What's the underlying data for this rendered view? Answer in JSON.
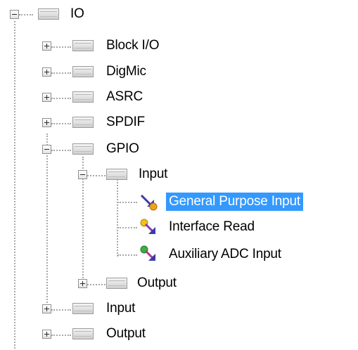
{
  "tree": {
    "root": {
      "label": "IO",
      "expanded": true
    },
    "items": [
      {
        "label": "Block I/O",
        "expanded": false,
        "icon": "folder-icon"
      },
      {
        "label": "DigMic",
        "expanded": false,
        "icon": "folder-icon"
      },
      {
        "label": "ASRC",
        "expanded": false,
        "icon": "folder-icon"
      },
      {
        "label": "SPDIF",
        "expanded": false,
        "icon": "folder-icon"
      },
      {
        "label": "GPIO",
        "expanded": true,
        "icon": "folder-icon"
      },
      {
        "label": "Input",
        "expanded": true,
        "icon": "folder-icon"
      },
      {
        "label": "General Purpose Input",
        "selected": true,
        "icon": "gpio-input-icon"
      },
      {
        "label": "Interface Read",
        "selected": false,
        "icon": "interface-read-icon"
      },
      {
        "label": "Auxiliary ADC Input",
        "selected": false,
        "icon": "aux-adc-icon"
      },
      {
        "label": "Output",
        "expanded": false,
        "icon": "folder-icon"
      },
      {
        "label": "Input",
        "expanded": false,
        "icon": "folder-icon"
      },
      {
        "label": "Output",
        "expanded": false,
        "icon": "folder-icon"
      }
    ]
  },
  "colors": {
    "selection": "#3399ff",
    "selection_text": "#ffffff",
    "tree_lines": "#a8a8a8",
    "text": "#000000"
  }
}
